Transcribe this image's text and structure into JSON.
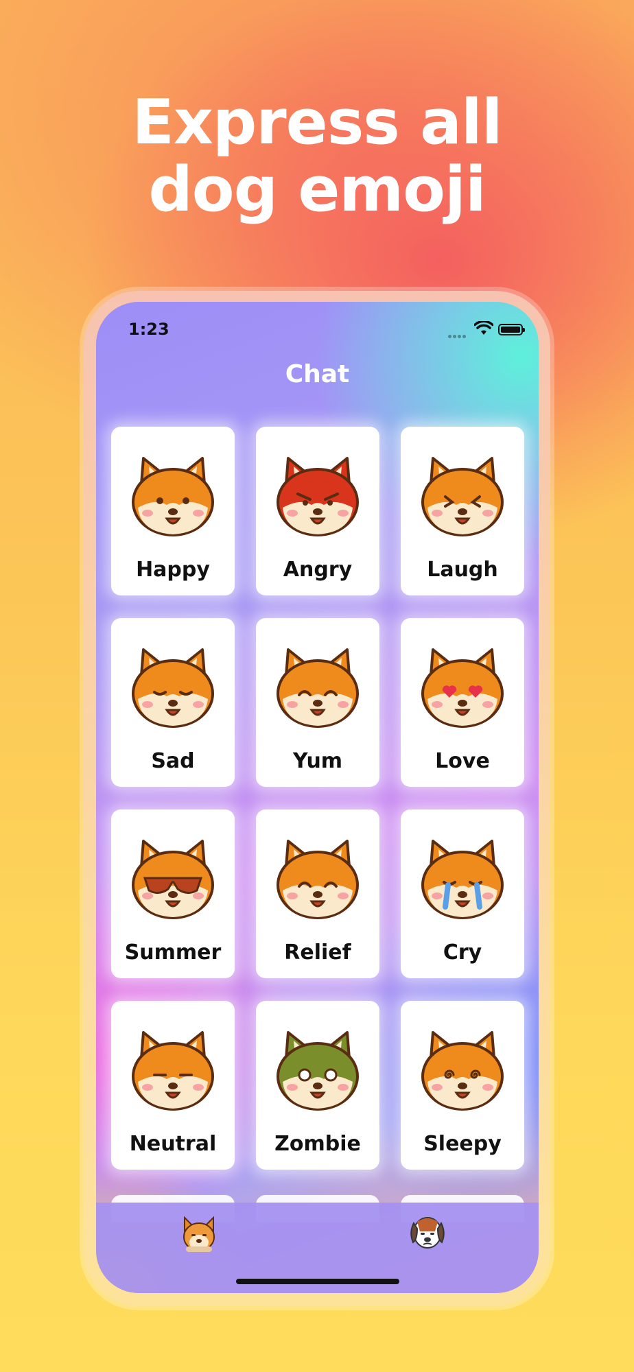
{
  "headline": "Express all dog emoji",
  "status_bar": {
    "time": "1:23"
  },
  "nav": {
    "title": "Chat"
  },
  "emojis": [
    {
      "label": "Happy",
      "face": "#ef8a1c",
      "eyes": "dots"
    },
    {
      "label": "Angry",
      "face": "#d9341c",
      "eyes": "angry"
    },
    {
      "label": "Laugh",
      "face": "#ef8a1c",
      "eyes": "x"
    },
    {
      "label": "Sad",
      "face": "#ef8a1c",
      "eyes": "closed-down"
    },
    {
      "label": "Yum",
      "face": "#ef8a1c",
      "eyes": "happy-arc"
    },
    {
      "label": "Love",
      "face": "#ef8a1c",
      "eyes": "hearts"
    },
    {
      "label": "Summer",
      "face": "#ef8a1c",
      "eyes": "sunglasses"
    },
    {
      "label": "Relief",
      "face": "#ef8a1c",
      "eyes": "happy-arc"
    },
    {
      "label": "Cry",
      "face": "#ef8a1c",
      "eyes": "tears"
    },
    {
      "label": "Neutral",
      "face": "#ef8a1c",
      "eyes": "flat"
    },
    {
      "label": "Zombie",
      "face": "#7a8f2c",
      "eyes": "blank"
    },
    {
      "label": "Sleepy",
      "face": "#ef8a1c",
      "eyes": "spiral"
    }
  ],
  "tabs": [
    {
      "icon": "shiba-icon"
    },
    {
      "icon": "beagle-icon"
    }
  ],
  "colors": {
    "accent": "#f4605f",
    "tab_bar": "#a591f0"
  }
}
